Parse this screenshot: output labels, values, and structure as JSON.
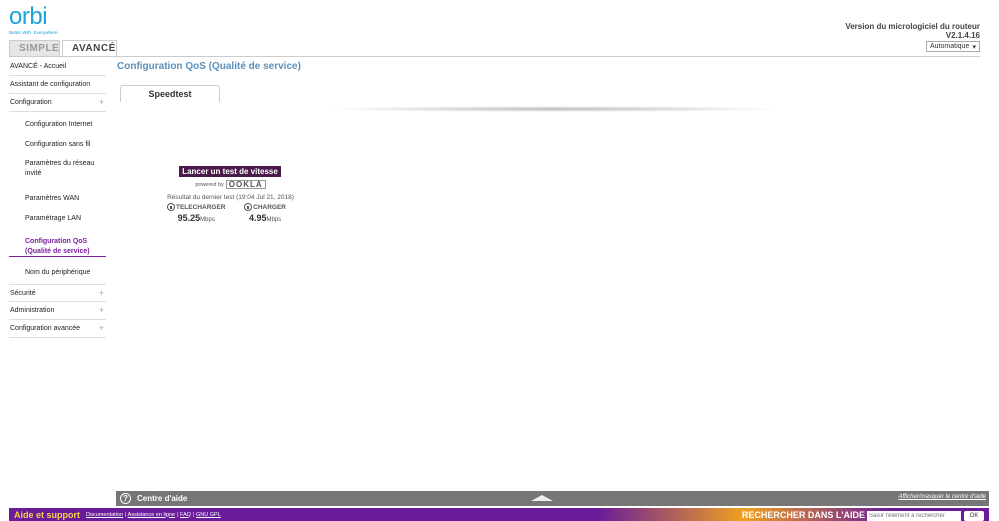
{
  "brand": {
    "name": "orbi",
    "tagline": "Better WiFi. Everywhere."
  },
  "firmware": {
    "label": "Version du micrologiciel du routeur",
    "version": "V2.1.4.16"
  },
  "language_select": {
    "value": "Automatique"
  },
  "tabs": {
    "simple": "SIMPLE",
    "avance": "AVANCÉ"
  },
  "sidebar": {
    "top_items": [
      {
        "label": "AVANCÉ - Accueil"
      },
      {
        "label": "Assistant de configuration"
      },
      {
        "label": "Configuration"
      }
    ],
    "sub_items": [
      {
        "label": "Configuration Internet"
      },
      {
        "label": "Configuration sans fil"
      },
      {
        "label": "Paramètres du réseau invité"
      },
      {
        "label": "Paramètres WAN"
      },
      {
        "label": "Paramétrage LAN"
      },
      {
        "label": "Configuration QoS (Qualité de service)"
      },
      {
        "label": "Nom du périphérique"
      }
    ],
    "bottom_items": [
      {
        "label": "Sécurité"
      },
      {
        "label": "Administration"
      },
      {
        "label": "Configuration avancée"
      }
    ]
  },
  "main": {
    "title": "Configuration QoS (Qualité de service)",
    "subtab": "Speedtest",
    "speedtest": {
      "button": "Lancer un test de vitesse",
      "powered_by": "powered by",
      "provider": "OOKLA",
      "last_result": "Résultat du dernier test (19:04 Jul 21, 2018)",
      "download_label": "TELECHARGER",
      "download_value": "95.25",
      "upload_label": "CHARGER",
      "upload_value": "4.95",
      "unit": "Mbps"
    }
  },
  "help": {
    "label": "Centre d'aide",
    "toggle": "Afficher/masquer le centre d'aide"
  },
  "footer": {
    "title": "Aide et support",
    "links": [
      "Documentation",
      "Assistance en ligne",
      "FAQ",
      "GNU GPL"
    ],
    "search_label": "RECHERCHER DANS L'AIDE",
    "search_placeholder": "Saisir l'élément à rechercher",
    "ok": "OK"
  }
}
